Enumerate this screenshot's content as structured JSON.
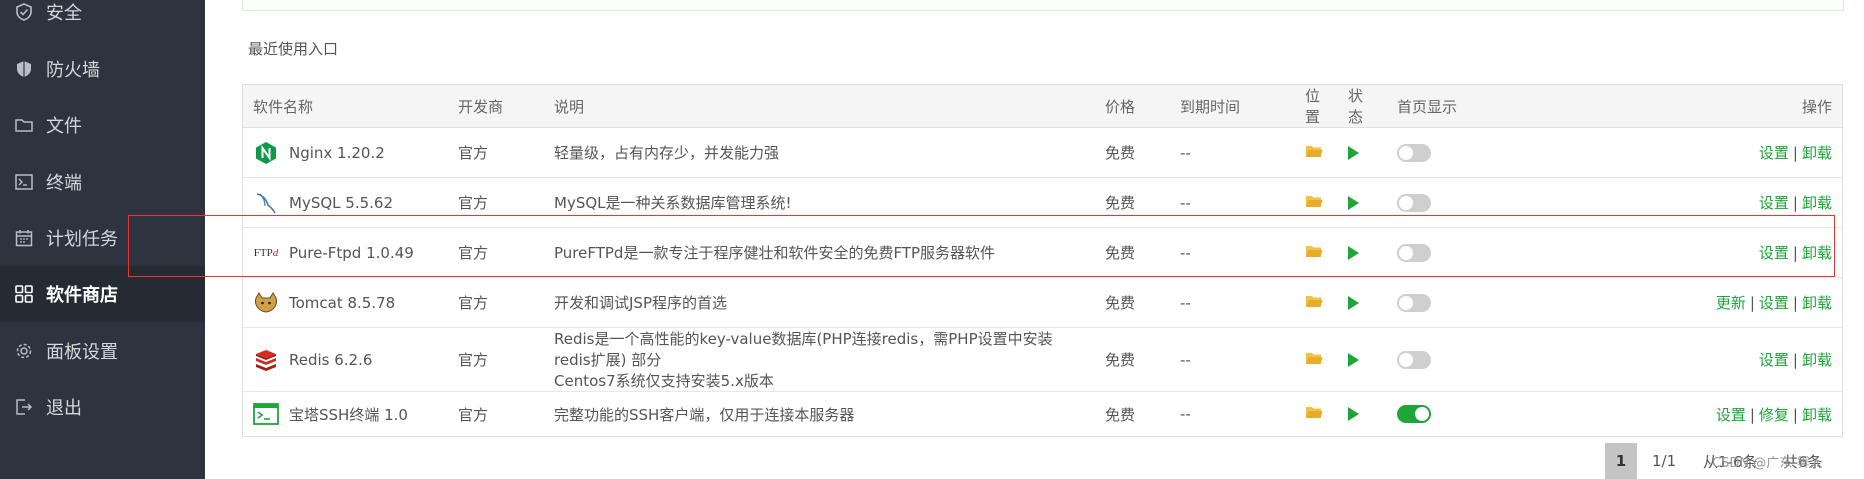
{
  "sidebar": {
    "items": [
      {
        "label": "安全",
        "icon": "shield-check-icon"
      },
      {
        "label": "防火墙",
        "icon": "firewall-shield-icon"
      },
      {
        "label": "文件",
        "icon": "folder-icon"
      },
      {
        "label": "终端",
        "icon": "terminal-icon"
      },
      {
        "label": "计划任务",
        "icon": "calendar-icon"
      },
      {
        "label": "软件商店",
        "icon": "grid-apps-icon",
        "active": true
      },
      {
        "label": "面板设置",
        "icon": "gear-icon"
      },
      {
        "label": "退出",
        "icon": "logout-icon"
      }
    ]
  },
  "main": {
    "recent_label": "最近使用入口",
    "columns": {
      "name": "软件名称",
      "vendor": "开发商",
      "desc": "说明",
      "price": "价格",
      "expire": "到期时间",
      "location": "位置",
      "status": "状态",
      "homepage": "首页显示",
      "ops": "操作"
    },
    "rows": [
      {
        "name": "Nginx 1.20.2",
        "logo": "nginx-logo-icon",
        "vendor": "官方",
        "desc": "轻量级，占有内存少，并发能力强",
        "desc2": "",
        "price": "免费",
        "expire": "--",
        "homepage_on": false,
        "ops": [
          "设置",
          "卸载"
        ]
      },
      {
        "name": "MySQL 5.5.62",
        "logo": "mysql-dolphin-icon",
        "vendor": "官方",
        "desc": "MySQL是一种关系数据库管理系统!",
        "desc2": "",
        "price": "免费",
        "expire": "--",
        "homepage_on": false,
        "ops": [
          "设置",
          "卸载"
        ]
      },
      {
        "name": "Pure-Ftpd 1.0.49",
        "logo": "ftp-logo-icon",
        "vendor": "官方",
        "desc": "PureFTPd是一款专注于程序健壮和软件安全的免费FTP服务器软件",
        "desc2": "",
        "price": "免费",
        "expire": "--",
        "homepage_on": false,
        "ops": [
          "设置",
          "卸载"
        ]
      },
      {
        "name": "Tomcat 8.5.78",
        "logo": "tomcat-logo-icon",
        "vendor": "官方",
        "desc": "开发和调试JSP程序的首选",
        "desc2": "",
        "price": "免费",
        "expire": "--",
        "homepage_on": false,
        "ops": [
          "更新",
          "设置",
          "卸载"
        ]
      },
      {
        "name": "Redis 6.2.6",
        "logo": "redis-logo-icon",
        "vendor": "官方",
        "desc": "Redis是一个高性能的key-value数据库(PHP连接redis，需PHP设置中安装redis扩展) 部分",
        "desc2": "Centos7系统仅支持安装5.x版本",
        "price": "免费",
        "expire": "--",
        "homepage_on": false,
        "ops": [
          "设置",
          "卸载"
        ]
      },
      {
        "name": "宝塔SSH终端 1.0",
        "logo": "ssh-terminal-icon",
        "vendor": "官方",
        "desc": "完整功能的SSH客户端，仅用于连接本服务器",
        "desc2": "",
        "price": "免费",
        "expire": "--",
        "homepage_on": true,
        "ops": [
          "设置",
          "修复",
          "卸载"
        ]
      }
    ],
    "ftp_logo_text": "FTP"
  },
  "pagination": {
    "current": "1",
    "pages": "1/1",
    "from": "从1-6条",
    "total": "共6条"
  },
  "watermark": "CSDN @广东-霁人",
  "colors": {
    "accent": "#20a53a",
    "sidebar_bg": "#2e3340",
    "highlight": "#e33333"
  }
}
